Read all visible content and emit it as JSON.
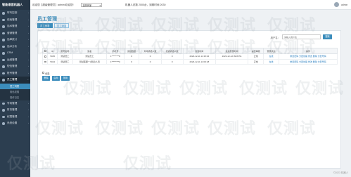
{
  "app": {
    "brand": "智能语音机器人"
  },
  "topbar": {
    "welcome": "欢迎您【超级管理员】admin!欢迎您!",
    "company_select": "选择商家",
    "stats": "机器人总数 2000台，到期时间 2030",
    "user": "admin"
  },
  "sidebar": {
    "items": [
      {
        "label": "呼叫控制"
      },
      {
        "label": "线索管理"
      },
      {
        "label": "话术管理"
      },
      {
        "label": "营销管理"
      },
      {
        "label": "话单统计"
      },
      {
        "label": "话术分析"
      },
      {
        "label": "CRM"
      },
      {
        "label": "运维管理"
      },
      {
        "label": "短信管理"
      },
      {
        "label": "账号管理"
      },
      {
        "label": "员工管理"
      }
    ],
    "subitems": [
      {
        "label": "员工列表"
      },
      {
        "label": "角色权限"
      },
      {
        "label": "操作日志"
      }
    ],
    "items_bottom": [
      {
        "label": "号码管理"
      },
      {
        "label": "财务管理"
      },
      {
        "label": "权限管理"
      },
      {
        "label": "系统设置"
      }
    ]
  },
  "page": {
    "title": "员工管理",
    "tabs": [
      "员工列表",
      "员工添加"
    ]
  },
  "search": {
    "label": "用户名：",
    "placeholder": "请输入用户名",
    "button": "搜索"
  },
  "table": {
    "columns": [
      "",
      "ID",
      "账号名称",
      "姓名",
      "手机号",
      "通话数量",
      "外呼通话人数",
      "接通通话人数",
      "创建时间",
      "最后登录时间",
      "是否审核",
      "登录状态",
      "操作"
    ],
    "rows": [
      [
        "",
        "5045",
        "测试员工",
        "测试员工",
        "1*********8",
        "0",
        "0",
        "0",
        "2023-12-11 14:15:04",
        "2023-12-12 09:05:51",
        "正常",
        "在线",
        "重置密码 分配线路 修改 删除 分配号码"
      ],
      [
        "",
        "5044",
        "测试员工",
        "测试客服一(测试)人员",
        "1*********0",
        "0",
        "0",
        "0",
        "2023-12-11 14:03:18",
        "",
        "正常",
        "在线",
        "重置密码 分配线路 修改 删除 分配号码"
      ]
    ]
  },
  "bulk": {
    "select_all": "全选",
    "buttons": [
      "删除",
      "启用",
      "禁用"
    ]
  },
  "watermarks": [
    "仅测试",
    "仅测试",
    "仅测试",
    "仅测试",
    "仅测试",
    "仅测试",
    "仅测试",
    "仅测试",
    "仅测试",
    "仅测试",
    "仅测试",
    "仅测试",
    "仅测试",
    "仅测试",
    "仅测试",
    "仅测试",
    "仅测试",
    "仅测试",
    "仅测试",
    "仅测试",
    "仅测试",
    "仅测试"
  ],
  "colors": {
    "sidebar": "#2c3e50",
    "accent": "#3c8dbc",
    "link": "#2a7fc0"
  },
  "footer": {
    "copyright": "©2023 机器人"
  }
}
